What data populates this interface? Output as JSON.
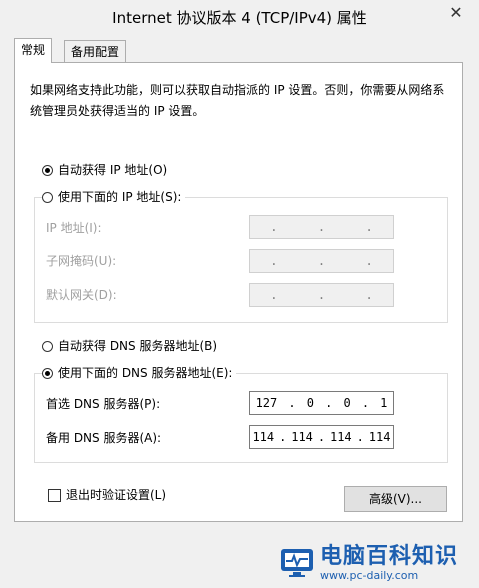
{
  "window": {
    "title": "Internet 协议版本 4 (TCP/IPv4) 属性",
    "close": "✕"
  },
  "tabs": [
    {
      "label": "常规"
    },
    {
      "label": "备用配置"
    }
  ],
  "description": "如果网络支持此功能，则可以获取自动指派的 IP 设置。否则，你需要从网络系统管理员处获得适当的 IP 设置。",
  "ip": {
    "auto_label": "自动获得 IP 地址(O)",
    "manual_label": "使用下面的 IP 地址(S):",
    "fields": [
      {
        "label": "IP 地址(I):",
        "value": [
          ".",
          ".",
          "."
        ]
      },
      {
        "label": "子网掩码(U):",
        "value": [
          ".",
          ".",
          "."
        ]
      },
      {
        "label": "默认网关(D):",
        "value": [
          ".",
          ".",
          "."
        ]
      }
    ]
  },
  "dns": {
    "auto_label": "自动获得 DNS 服务器地址(B)",
    "manual_label": "使用下面的 DNS 服务器地址(E):",
    "preferred": {
      "label": "首选 DNS 服务器(P):",
      "octets": [
        "127",
        ".",
        "0",
        ".",
        "0",
        ".",
        "1"
      ]
    },
    "alternate": {
      "label": "备用 DNS 服务器(A):",
      "octets": [
        "114",
        ".",
        "114",
        ".",
        "114",
        ".",
        "114"
      ]
    }
  },
  "validate_label": "退出时验证设置(L)",
  "advanced_label": "高级(V)...",
  "watermark": {
    "cn": "电脑百科知识",
    "url": "www.pc-daily.com"
  }
}
